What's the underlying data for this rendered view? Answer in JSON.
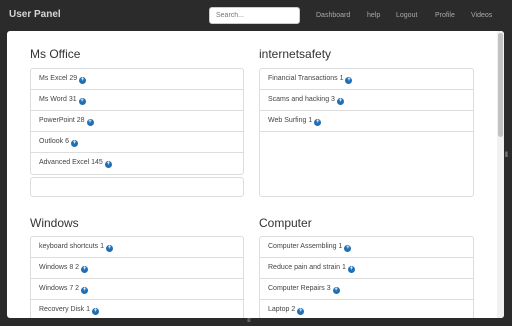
{
  "navbar": {
    "brand": "User Panel",
    "search_placeholder": "Search...",
    "links": [
      "Dashboard",
      "help",
      "Logout",
      "Profile",
      "Videos"
    ]
  },
  "sections": [
    {
      "title": "Ms Office",
      "items": [
        "Ms Excel 29",
        "Ms Word 31",
        "PowerPoint 28",
        "Outlook 6",
        "Advanced Excel 145"
      ]
    },
    {
      "title": "internetsafety",
      "items": [
        "Financial Transactions 1",
        "Scams and hacking 3",
        "Web Surfing 1"
      ]
    },
    {
      "title": "Windows",
      "items": [
        "keyboard shortcuts 1",
        "Windows 8 2",
        "Windows 7 2",
        "Recovery Disk 1"
      ]
    },
    {
      "title": "Computer",
      "items": [
        "Computer Assembling 1",
        "Reduce pain and strain 1",
        "Computer Repairs 3",
        "Laptop 2"
      ]
    }
  ],
  "icons": {
    "add": "plus-circle-icon",
    "grip": "resize-grip-icon"
  },
  "colors": {
    "navbar_bg": "#2b2b2b",
    "accent": "#1f6fb5"
  }
}
